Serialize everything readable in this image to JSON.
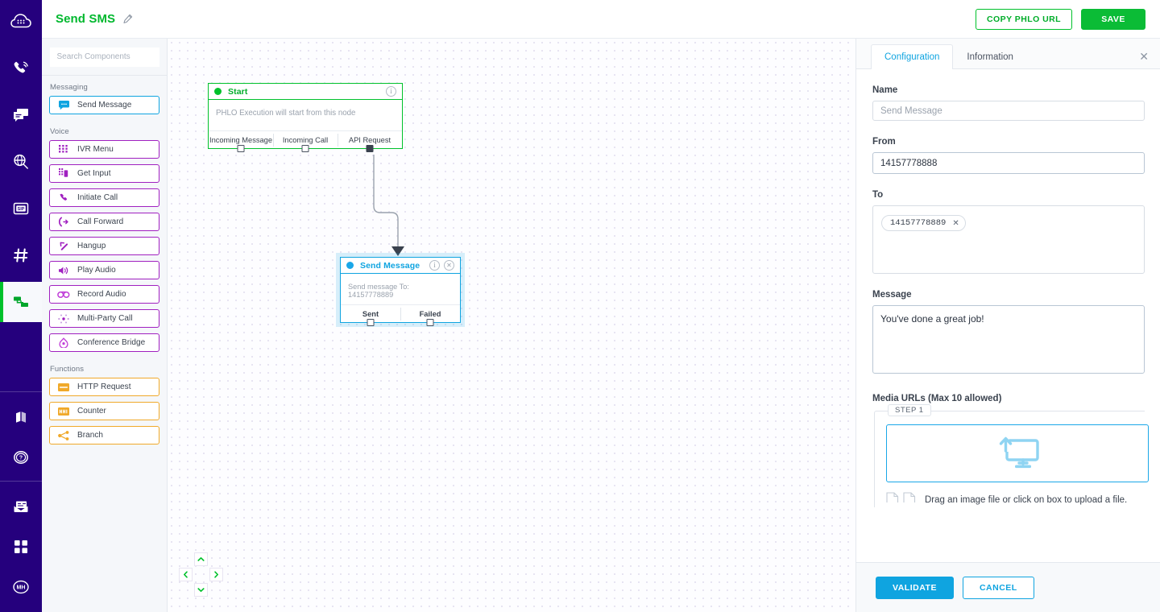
{
  "topbar": {
    "phlo_title": "Send SMS",
    "edit_icon": "pencil-icon",
    "copy_url_label": "COPY PHLO URL",
    "save_label": "SAVE",
    "green": "#00c12b"
  },
  "rail": {
    "items": [
      {
        "icon": "cloud-keypad-icon",
        "name": "brand-logo"
      },
      {
        "icon": "phone-waves-icon",
        "name": "voice"
      },
      {
        "icon": "messages-icon",
        "name": "messaging"
      },
      {
        "icon": "globe-search-icon",
        "name": "lookup"
      },
      {
        "icon": "sip-card-icon",
        "name": "sip"
      },
      {
        "icon": "hash-icon",
        "name": "numbers"
      },
      {
        "icon": "flow-nodes-icon",
        "name": "phlo",
        "active": true
      },
      {
        "icon": "book-icon",
        "name": "docs"
      },
      {
        "icon": "help-circle-icon",
        "name": "help"
      },
      {
        "icon": "billing-envelope-icon",
        "name": "billing"
      },
      {
        "icon": "apps-grid-icon",
        "name": "apps"
      },
      {
        "icon": "avatar-mh-icon",
        "name": "account",
        "initials": "MH"
      }
    ]
  },
  "palette": {
    "search": {
      "placeholder": "Search Components",
      "value": ""
    },
    "groups": [
      {
        "label": "Messaging",
        "color": "blue",
        "items": [
          {
            "label": "Send Message",
            "icon": "chat-bubble-icon"
          }
        ]
      },
      {
        "label": "Voice",
        "color": "purple",
        "items": [
          {
            "label": "IVR Menu",
            "icon": "keypad-icon"
          },
          {
            "label": "Get Input",
            "icon": "input-keypad-icon"
          },
          {
            "label": "Initiate Call",
            "icon": "phone-icon"
          },
          {
            "label": "Call Forward",
            "icon": "call-forward-icon"
          },
          {
            "label": "Hangup",
            "icon": "hangup-icon"
          },
          {
            "label": "Play Audio",
            "icon": "speaker-icon"
          },
          {
            "label": "Record Audio",
            "icon": "record-icon"
          },
          {
            "label": "Multi-Party Call",
            "icon": "multiparty-icon"
          },
          {
            "label": "Conference Bridge",
            "icon": "conference-icon"
          }
        ]
      },
      {
        "label": "Functions",
        "color": "amber",
        "items": [
          {
            "label": "HTTP Request",
            "icon": "http-icon"
          },
          {
            "label": "Counter",
            "icon": "counter-icon"
          },
          {
            "label": "Branch",
            "icon": "branch-icon"
          }
        ]
      }
    ]
  },
  "canvas": {
    "nodes": [
      {
        "id": "start",
        "title": "Start",
        "body": "PHLO Execution will start from this node",
        "accent": "#00c12b",
        "info_icon": "info-icon",
        "ports": [
          {
            "label": "Incoming Message",
            "filled": false
          },
          {
            "label": "Incoming Call",
            "filled": false
          },
          {
            "label": "API Request",
            "filled": true
          }
        ]
      },
      {
        "id": "send-message",
        "title": "Send Message",
        "body": "Send message To: 14157778889",
        "accent": "#0fa4e0",
        "info_icon": "info-icon",
        "close_icon": "close-circle-icon",
        "selected": true,
        "ports": [
          {
            "label": "Sent",
            "filled": false
          },
          {
            "label": "Failed",
            "filled": false
          }
        ]
      }
    ],
    "pan": {
      "up": "chevron-up-icon",
      "down": "chevron-down-icon",
      "left": "chevron-left-icon",
      "right": "chevron-right-icon"
    }
  },
  "panel": {
    "tabs": [
      {
        "label": "Configuration",
        "active": true
      },
      {
        "label": "Information",
        "active": false
      }
    ],
    "close_icon": "close-icon",
    "fields": {
      "name_label": "Name",
      "name_value": "Send Message",
      "from_label": "From",
      "from_value": "14157778888",
      "to_label": "To",
      "to_chips": [
        "14157778889"
      ],
      "message_label": "Message",
      "message_value": "You've done a great job!",
      "media_label": "Media URLs (Max 10 allowed)",
      "step_badge": "STEP 1",
      "upload_icon": "monitor-upload-icon",
      "drop_hint": "Drag an image file or click on box to upload a file."
    },
    "footer": {
      "validate_label": "VALIDATE",
      "cancel_label": "CANCEL"
    }
  }
}
